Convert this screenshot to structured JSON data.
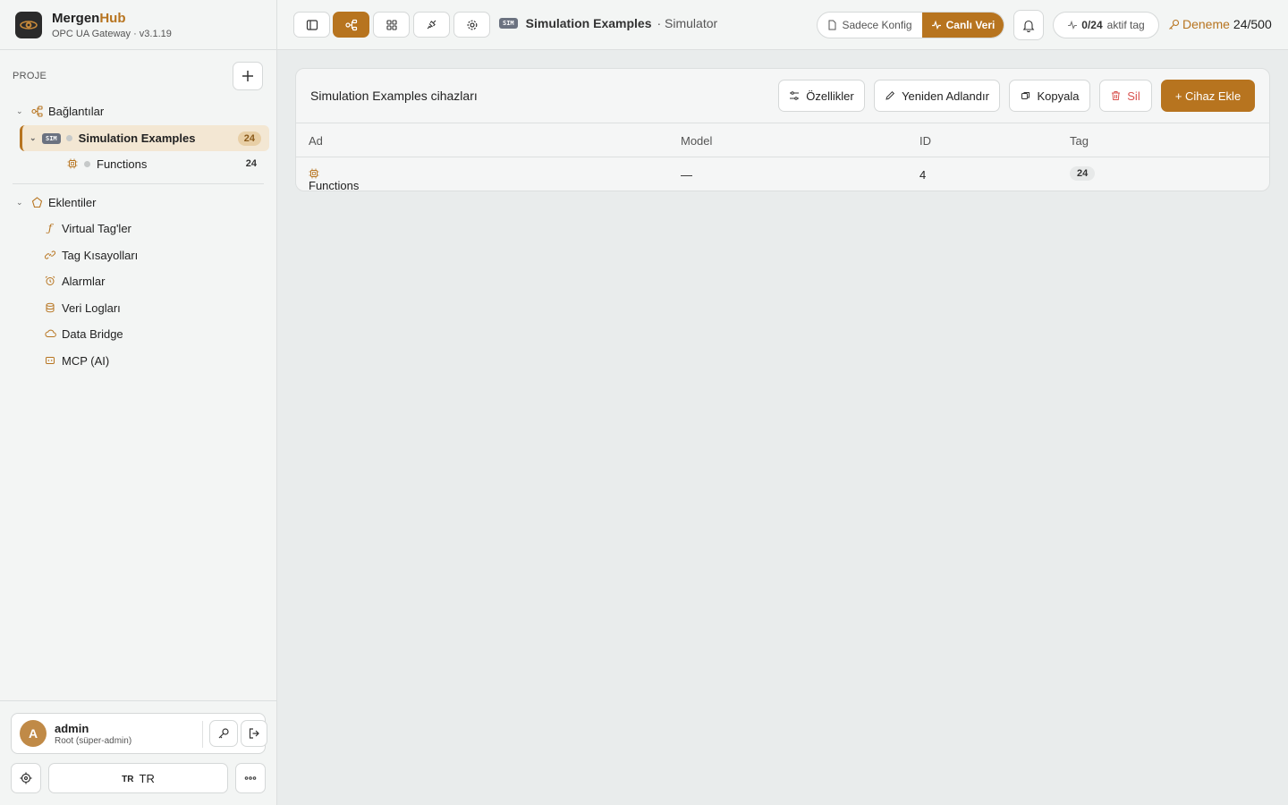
{
  "brand": {
    "name_a": "Mergen",
    "name_b": "Hub",
    "subtitle": "OPC UA Gateway · v3.1.19"
  },
  "sidebar": {
    "section_label": "PROJE",
    "connections": {
      "label": "Bağlantılar",
      "items": [
        {
          "badge": "SIM",
          "label": "Simulation Examples",
          "count": "24",
          "selected": true,
          "children": [
            {
              "label": "Functions",
              "count": "24"
            }
          ]
        }
      ]
    },
    "plugins": {
      "label": "Eklentiler",
      "items": [
        {
          "label": "Virtual Tag'ler",
          "icon": "function-icon"
        },
        {
          "label": "Tag Kısayolları",
          "icon": "link-icon"
        },
        {
          "label": "Alarmlar",
          "icon": "alarm-icon"
        },
        {
          "label": "Veri Logları",
          "icon": "database-icon"
        },
        {
          "label": "Data Bridge",
          "icon": "cloud-icon"
        },
        {
          "label": "MCP (AI)",
          "icon": "ai-icon"
        }
      ]
    },
    "user": {
      "initial": "A",
      "name": "admin",
      "role": "Root (süper-admin)"
    },
    "language": {
      "code": "TR",
      "label": "TR"
    }
  },
  "topbar": {
    "breadcrumb_badge": "SIM",
    "breadcrumb_title": "Simulation Examples",
    "breadcrumb_sub": "· Simulator",
    "mode_config": "Sadece Konfig",
    "mode_live": "Canlı Veri",
    "active_tags": "0/24",
    "active_tags_label": "aktif tag",
    "trial_label": "Deneme",
    "trial_count": "24/500"
  },
  "main": {
    "title": "Simulation Examples cihazları",
    "actions": {
      "properties": "Özellikler",
      "rename": "Yeniden Adlandır",
      "copy": "Kopyala",
      "delete": "Sil",
      "add_device": "+ Cihaz Ekle"
    },
    "columns": [
      "Ad",
      "Model",
      "ID",
      "Tag"
    ],
    "rows": [
      {
        "name": "Functions",
        "model": "—",
        "id": "4",
        "tags": "24"
      }
    ]
  },
  "colors": {
    "accent": "#b7741f",
    "danger": "#d9534f",
    "selected_bg": "#f3e7d3"
  }
}
